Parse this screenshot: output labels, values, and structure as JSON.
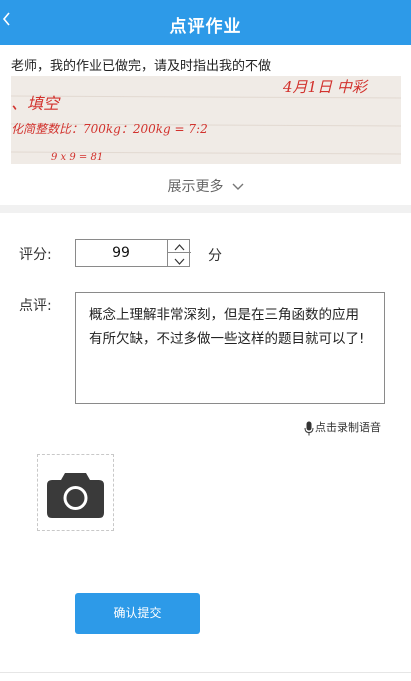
{
  "header": {
    "back_icon": "chevron-left-icon",
    "title": "点评作业"
  },
  "submission": {
    "message": "老师，我的作业已做完，请及时指出我的不做",
    "handwriting": {
      "line1": "、填空",
      "line2": "化简整数比：700kg：200kg = 7:2",
      "line3": "9 x 9 = 81",
      "corner": "4月1日 中彩"
    },
    "show_more_label": "展示更多",
    "show_more_icon": "chevron-down-icon"
  },
  "grading": {
    "score_label": "评分:",
    "score_value": "99",
    "score_unit": "分",
    "comment_label": "点评:",
    "comment_text": "概念上理解非常深刻，但是在三角函数的应用有所欠缺，不过多做一些这样的题目就可以了!",
    "voice_icon": "microphone-icon",
    "voice_label": "点击录制语音",
    "camera_icon": "camera-icon",
    "submit_label": "确认提交"
  },
  "colors": {
    "accent": "#2d9ae8",
    "ink": "#d2322d"
  }
}
